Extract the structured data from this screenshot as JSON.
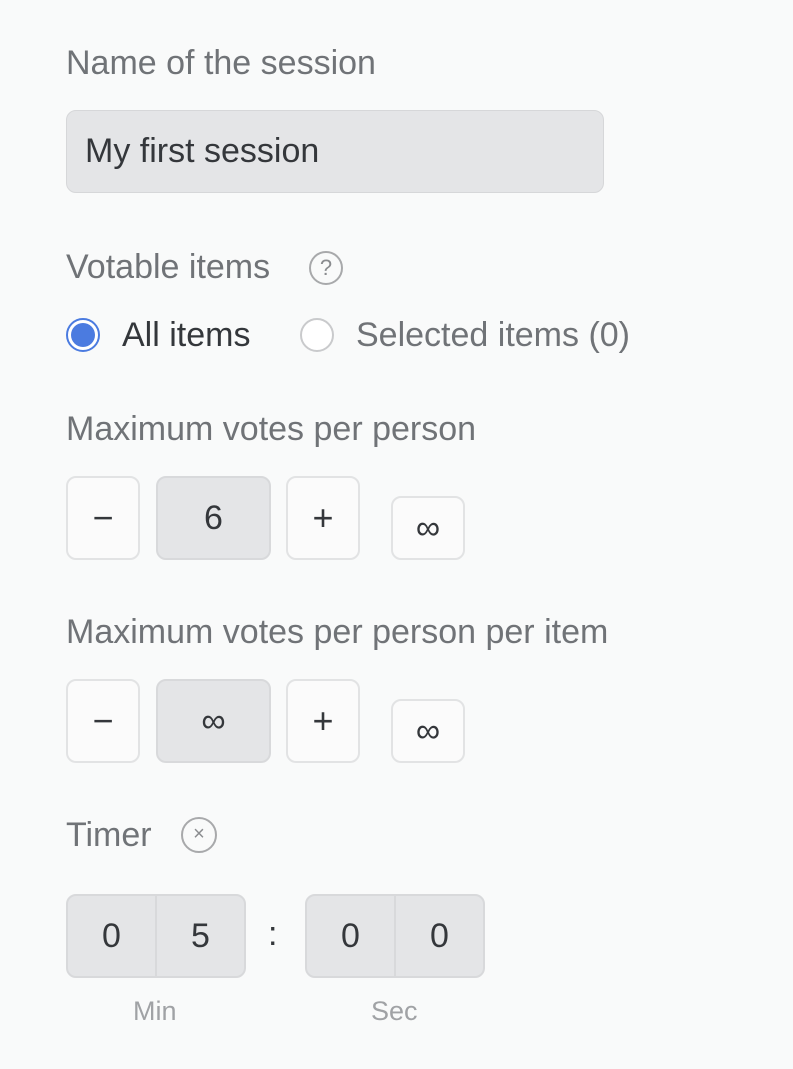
{
  "session_name": {
    "label": "Name of the session",
    "value": "My first session"
  },
  "votable_items": {
    "label": "Votable items",
    "help_icon": "?",
    "options": [
      {
        "label": "All items",
        "selected": true
      },
      {
        "label": "Selected items (0)",
        "selected": false
      }
    ]
  },
  "max_votes_per_person": {
    "label": "Maximum votes per person",
    "decrement": "−",
    "value": "6",
    "increment": "+",
    "infinity": "∞"
  },
  "max_votes_per_item": {
    "label": "Maximum votes per person per item",
    "decrement": "−",
    "value": "∞",
    "increment": "+",
    "infinity": "∞"
  },
  "timer": {
    "label": "Timer",
    "clear_icon": "×",
    "minutes": [
      "0",
      "5"
    ],
    "separator": ":",
    "seconds": [
      "0",
      "0"
    ],
    "min_label": "Min",
    "sec_label": "Sec"
  },
  "colors": {
    "accent": "#4b7be0",
    "background": "#f9fafa",
    "input_bg": "#e4e5e7"
  }
}
